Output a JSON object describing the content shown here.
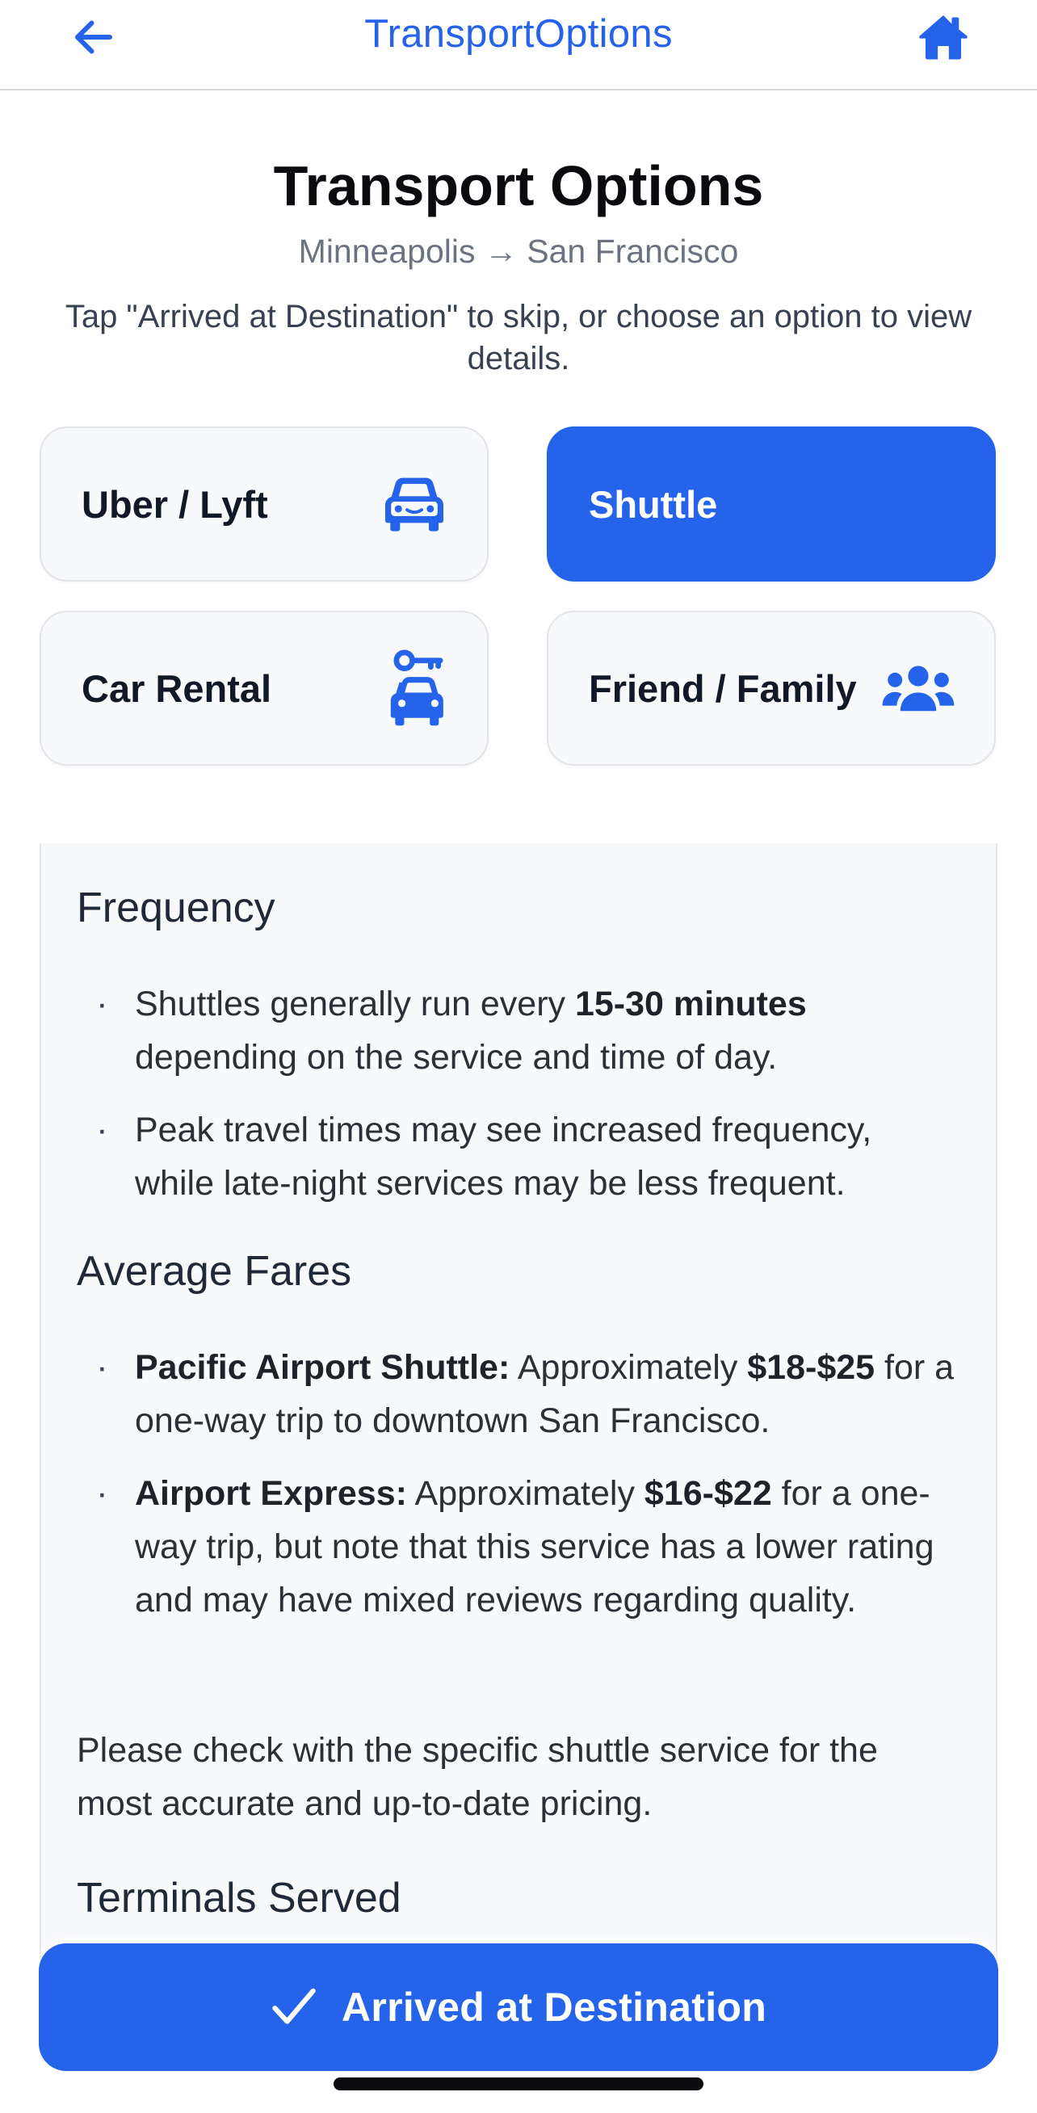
{
  "nav": {
    "title": "TransportOptions",
    "back_icon": "arrow-left-icon",
    "home_icon": "home-icon"
  },
  "header": {
    "title": "Transport Options",
    "route": "Minneapolis → San Francisco",
    "instructions": "Tap \"Arrived at Destination\" to skip, or choose an option to view details."
  },
  "options": [
    {
      "label": "Uber / Lyft",
      "icon": "car-front-icon",
      "selected": false
    },
    {
      "label": "Shuttle",
      "icon": "shuttle-icon",
      "selected": true
    },
    {
      "label": "Car Rental",
      "icon": "car-key-icon",
      "selected": false
    },
    {
      "label": "Friend / Family",
      "icon": "users-icon",
      "selected": false
    }
  ],
  "details": {
    "frequency": {
      "heading": "Frequency",
      "b1_pre": "Shuttles generally run every ",
      "b1_bold": "15-30 minutes",
      "b1_post": " depending on the service and time of day.",
      "b2": "Peak travel times may see increased frequency, while late-night services may be less frequent."
    },
    "fares": {
      "heading": "Average Fares",
      "pacific_name": "Pacific Airport Shuttle:",
      "pacific_pre": " Approximately ",
      "pacific_price": "$18-$25",
      "pacific_post": " for a one-way trip to downtown San Francisco.",
      "express_name": "Airport Express:",
      "express_pre": " Approximately ",
      "express_price": "$16-$22",
      "express_post": " for a one-way trip, but note that this service has a lower rating and may have mixed reviews regarding quality."
    },
    "note": "Please check with the specific shuttle service for the most accurate and up-to-date pricing.",
    "terminals_heading": "Terminals Served"
  },
  "footer": {
    "arrived_label": "Arrived at Destination",
    "arrived_icon": "checkmark-icon"
  },
  "colors": {
    "accent": "#2563eb",
    "card_bg": "#f8f9fb",
    "card_border": "#e2e4e9"
  }
}
